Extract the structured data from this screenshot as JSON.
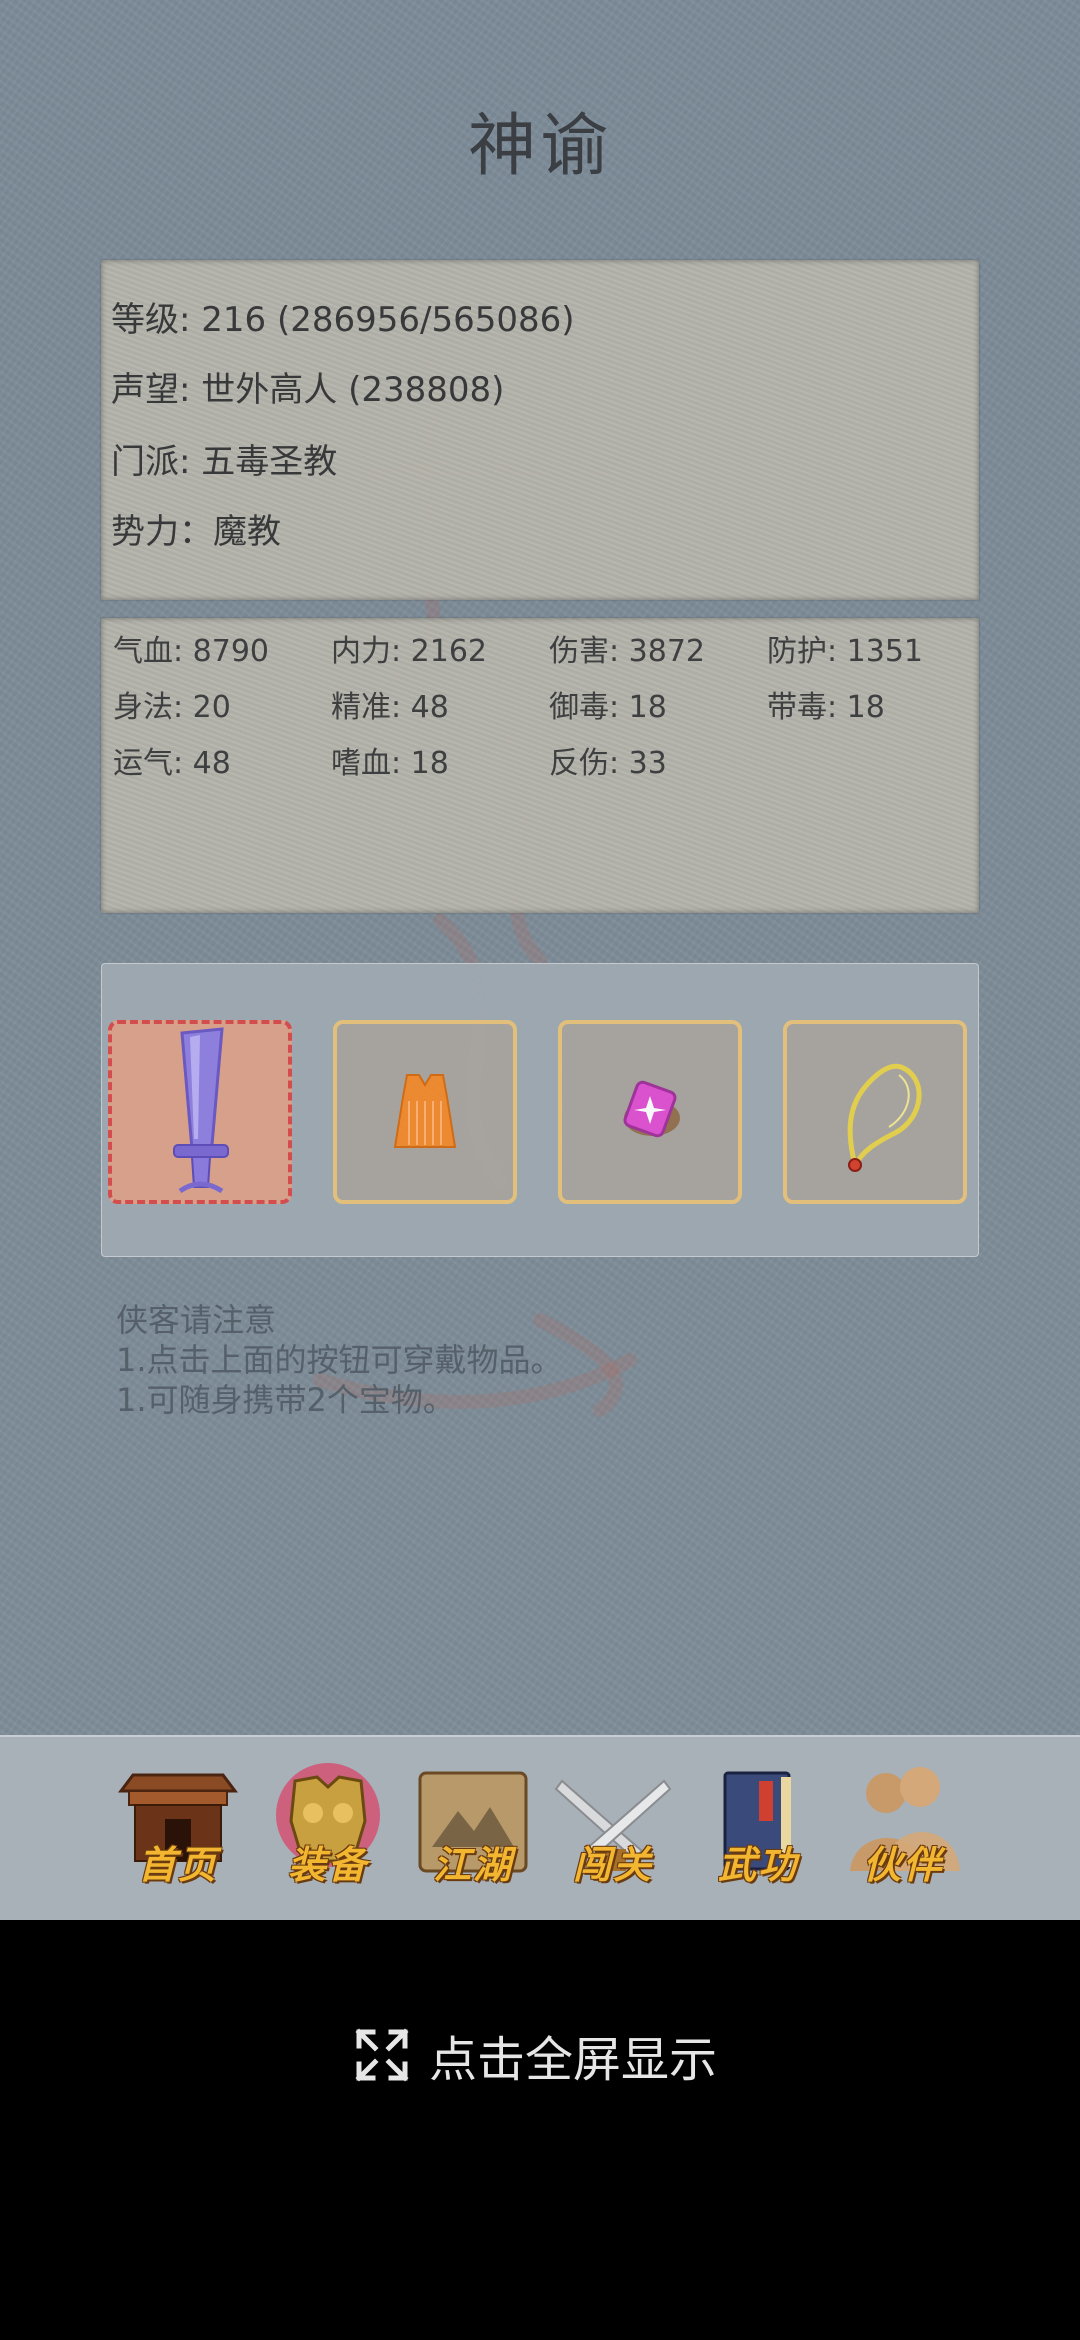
{
  "page": {
    "title": "神谕"
  },
  "info": {
    "level_label": "等级: 216 (286956/565086)",
    "reputation_label": "声望: 世外高人 (238808)",
    "sect_label": "门派: 五毒圣教",
    "faction_label": "势力：魔教"
  },
  "stats": [
    "气血: 8790",
    "内力: 2162",
    "伤害: 3872",
    "防护: 1351",
    "身法: 20",
    "精准: 48",
    "御毒: 18",
    "带毒: 18",
    "运气: 48",
    "嗜血: 18",
    "反伤: 33"
  ],
  "equipment": {
    "slots": [
      {
        "icon": "sword-icon",
        "selected": true
      },
      {
        "icon": "armor-vest-icon",
        "selected": false
      },
      {
        "icon": "pink-gem-icon",
        "selected": false
      },
      {
        "icon": "necklace-icon",
        "selected": false
      }
    ]
  },
  "notice": {
    "title": "侠客请注意",
    "line1": "1.点击上面的按钮可穿戴物品。",
    "line2": "1.可随身携带2个宝物。"
  },
  "nav": {
    "items": [
      {
        "label": "首页",
        "icon": "house-icon"
      },
      {
        "label": "装备",
        "icon": "armor-icon"
      },
      {
        "label": "江湖",
        "icon": "scroll-map-icon"
      },
      {
        "label": "闯关",
        "icon": "crossed-swords-icon"
      },
      {
        "label": "武功",
        "icon": "book-icon"
      },
      {
        "label": "伙伴",
        "icon": "partners-icon"
      }
    ]
  },
  "fullscreen": {
    "label": "点击全屏显示",
    "icon": "expand-icon"
  },
  "colors": {
    "background": "#7f8e9a",
    "panel": "#b8b7ad",
    "slot_border": "#e8c27a",
    "slot_selected_border": "#d94a4a",
    "nav_label": "#f2b630"
  }
}
